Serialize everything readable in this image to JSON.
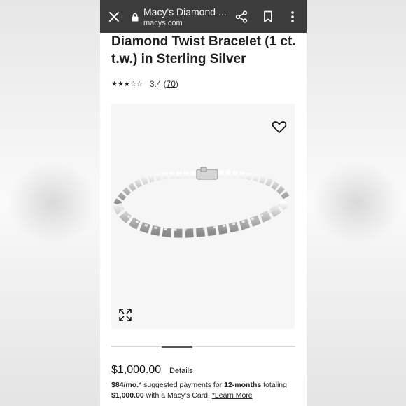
{
  "browser": {
    "page_title": "Macy's Diamond ...",
    "url": "macys.com",
    "icons": [
      "close-icon",
      "lock-icon",
      "share-icon",
      "bookmark-icon",
      "more-vert-icon"
    ]
  },
  "product": {
    "title": "Diamond Twist Bracelet (1 ct. t.w.) in Sterling Silver",
    "stars_text": "★★★☆☆",
    "rating": 3.4,
    "rating_text": "3.4",
    "review_open": "(",
    "review_count": "70",
    "review_close": ")"
  },
  "gallery": {
    "favorite_icon": "heart-outline-icon",
    "expand_icon": "expand-arrows-icon",
    "scroll_position": 0.33
  },
  "pricing": {
    "price": "$1,000.00",
    "details_label": "Details",
    "monthly": "$84/mo.",
    "asterisk": "*",
    "suggest_text": " suggested payments for ",
    "term": "12-months",
    "totaling": " totaling ",
    "total": "$1,000.00",
    "card_text": " with a Macy's Card. ",
    "learn_more": "*Learn More"
  },
  "colors": {
    "topbar": "#3c3c3c",
    "text": "#1f1f1f",
    "background": "#ffffff"
  }
}
